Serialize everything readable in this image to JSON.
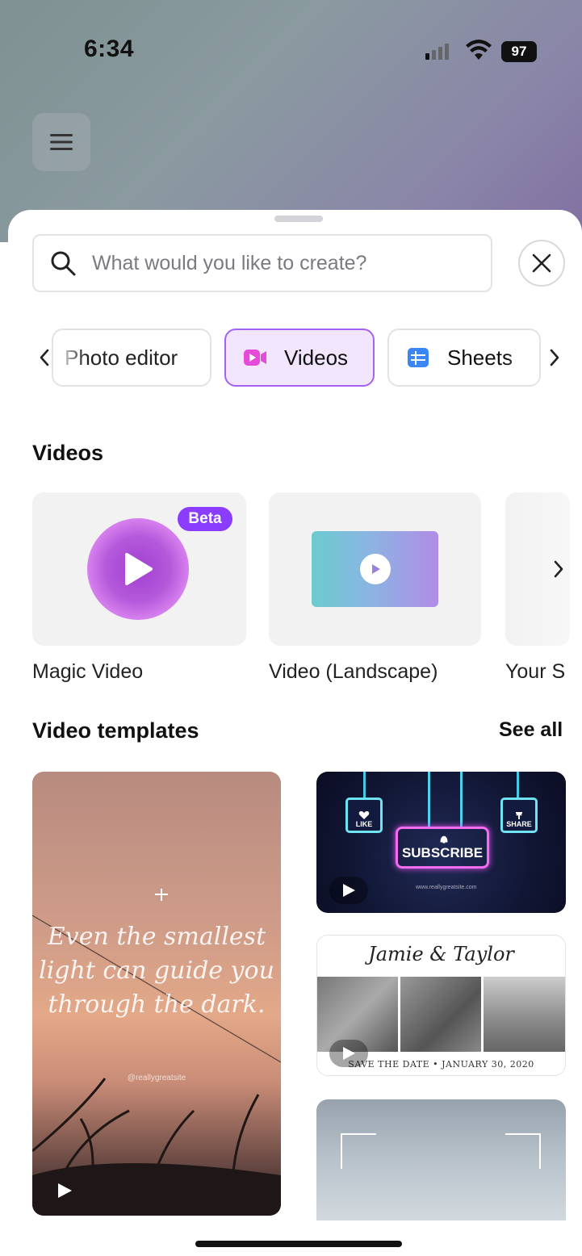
{
  "status_bar": {
    "time": "6:34",
    "battery": "97"
  },
  "header": {
    "menu_icon": "hamburger-icon"
  },
  "search": {
    "placeholder": "What would you like to create?",
    "icon": "search-icon",
    "close_icon": "close-icon"
  },
  "categories": {
    "items": [
      {
        "label": "Photo editor",
        "icon": null
      },
      {
        "label": "Videos",
        "icon": "video-camera-icon",
        "selected": true
      },
      {
        "label": "Sheets",
        "icon": "sheets-grid-icon"
      }
    ],
    "prev_icon": "chevron-left-icon",
    "next_icon": "chevron-right-icon"
  },
  "videos_section": {
    "title": "Videos",
    "cards": [
      {
        "label": "Magic Video",
        "badge": "Beta"
      },
      {
        "label": "Video (Landscape)"
      },
      {
        "label": "Your S"
      }
    ]
  },
  "templates_section": {
    "title": "Video templates",
    "see_all": "See all",
    "quote": "Even the smallest light can guide you through the dark.",
    "quote_credit": "@reallygreatsite",
    "neon": {
      "like": "LIKE",
      "share": "SHARE",
      "subscribe": "SUBSCRIBE",
      "url": "www.reallygreatsite.com"
    },
    "wedding": {
      "names": "Jamie & Taylor",
      "date": "SAVE THE DATE • JANUARY 30, 2020"
    }
  },
  "colors": {
    "accent": "#8b3dff",
    "selected_chip_bg": "#f1e6fd",
    "selected_chip_border": "#a463f2"
  }
}
